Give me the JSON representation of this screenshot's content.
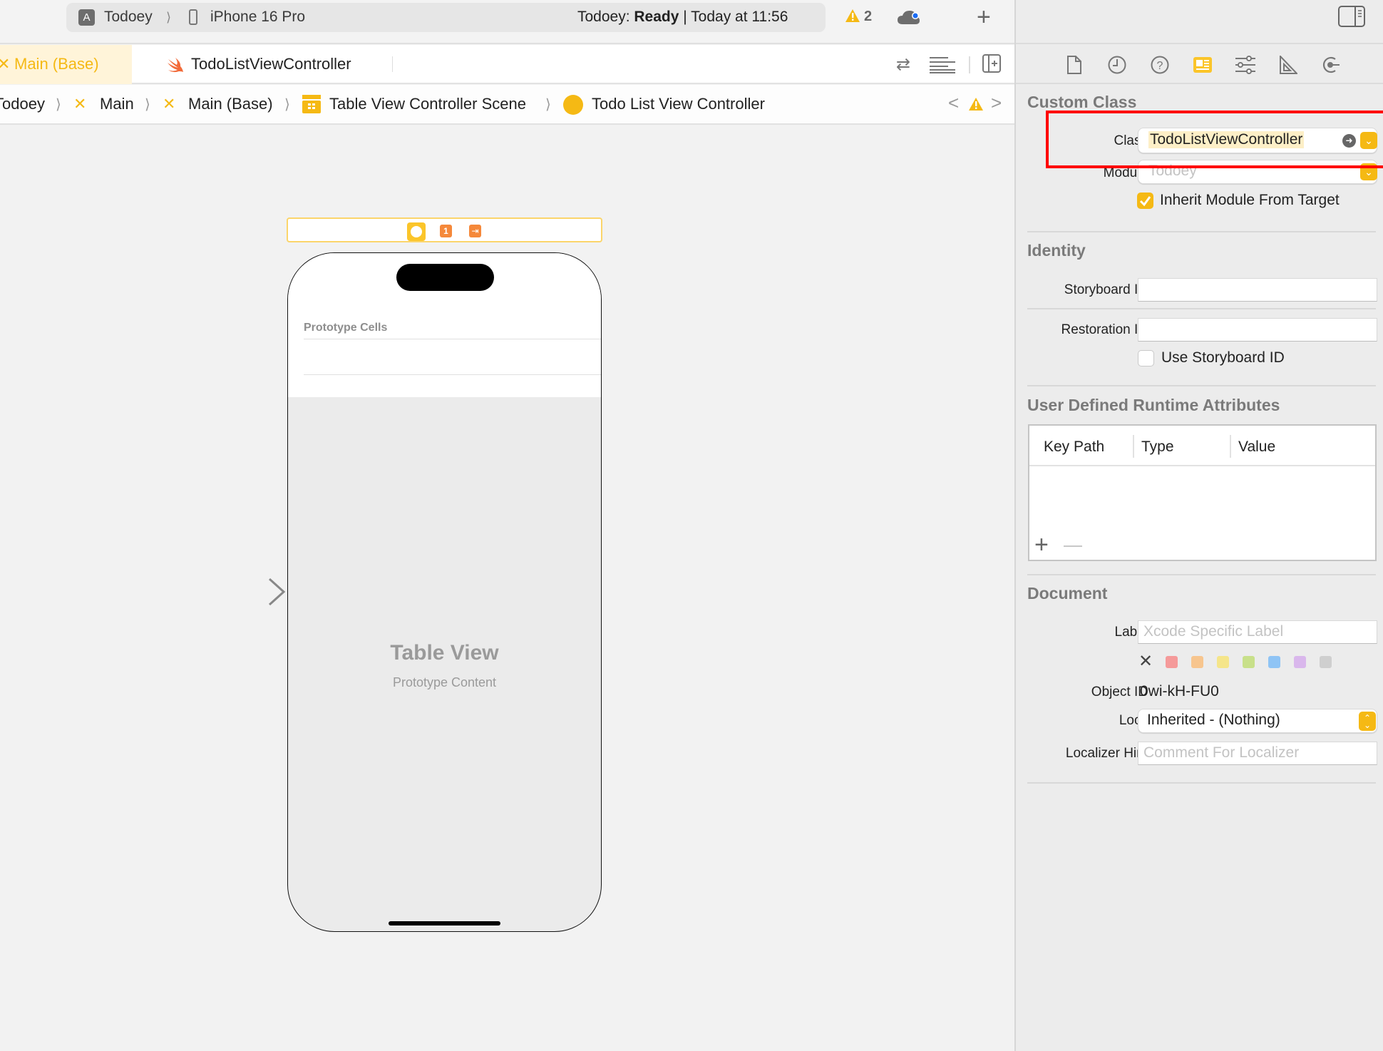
{
  "toolbar": {
    "scheme": "Todoey",
    "device": "iPhone 16 Pro",
    "status_project": "Todoey: ",
    "status_state": "Ready",
    "status_time": "| Today at 11:56",
    "warning_count": "2",
    "icons": [
      "app-scheme-icon",
      "iphone-icon",
      "warning-icon",
      "cloud-sync-icon",
      "add-icon",
      "inspector-toggle-icon"
    ]
  },
  "tabs": [
    {
      "label": "Main (Base)",
      "active": true,
      "icon": "storyboard-icon"
    },
    {
      "label": "TodoListViewController",
      "active": false,
      "icon": "swift-icon"
    }
  ],
  "editor_options": [
    "related-items-icon",
    "editor-options-icon",
    "add-editor-icon"
  ],
  "jumpbar": {
    "items": [
      "Todoey",
      "Main",
      "Main (Base)",
      "Table View Controller Scene",
      "Todo List View Controller"
    ]
  },
  "canvas": {
    "prototype_cells_label": "Prototype Cells",
    "table_view_title": "Table View",
    "table_view_subtitle": "Prototype Content",
    "scene_dock_icons": [
      "view-controller-icon",
      "first-responder-icon",
      "exit-icon"
    ]
  },
  "inspector": {
    "tab_icons": [
      "file-icon",
      "history-icon",
      "help-icon",
      "identity-icon",
      "attributes-icon",
      "size-icon",
      "connections-icon"
    ],
    "custom_class": {
      "title": "Custom Class",
      "class_label": "Class",
      "class_value": "TodoListViewController",
      "module_label": "Module",
      "module_placeholder": "Todoey",
      "inherit_label": "Inherit Module From Target",
      "inherit_checked": true
    },
    "identity": {
      "title": "Identity",
      "storyboard_id_label": "Storyboard ID",
      "storyboard_id_value": "",
      "restoration_id_label": "Restoration ID",
      "restoration_id_value": "",
      "use_storyboard_id_label": "Use Storyboard ID",
      "use_storyboard_id_checked": false
    },
    "udra": {
      "title": "User Defined Runtime Attributes",
      "columns": [
        "Key Path",
        "Type",
        "Value"
      ],
      "rows": []
    },
    "document": {
      "title": "Document",
      "label_label": "Label",
      "label_placeholder": "Xcode Specific Label",
      "label_colors": [
        "#f59a9a",
        "#f7c58e",
        "#f5e58a",
        "#c8e08a",
        "#8fc4f5",
        "#d9b7ec",
        "#cfcfcf"
      ],
      "object_id_label": "Object ID",
      "object_id_value": "0wi-kH-FU0",
      "lock_label": "Lock",
      "lock_value": "Inherited - (Nothing)",
      "localizer_label": "Localizer Hint",
      "localizer_placeholder": "Comment For Localizer"
    }
  },
  "colors": {
    "accent": "#f5b914",
    "highlight_annotation": "#ff0000"
  }
}
